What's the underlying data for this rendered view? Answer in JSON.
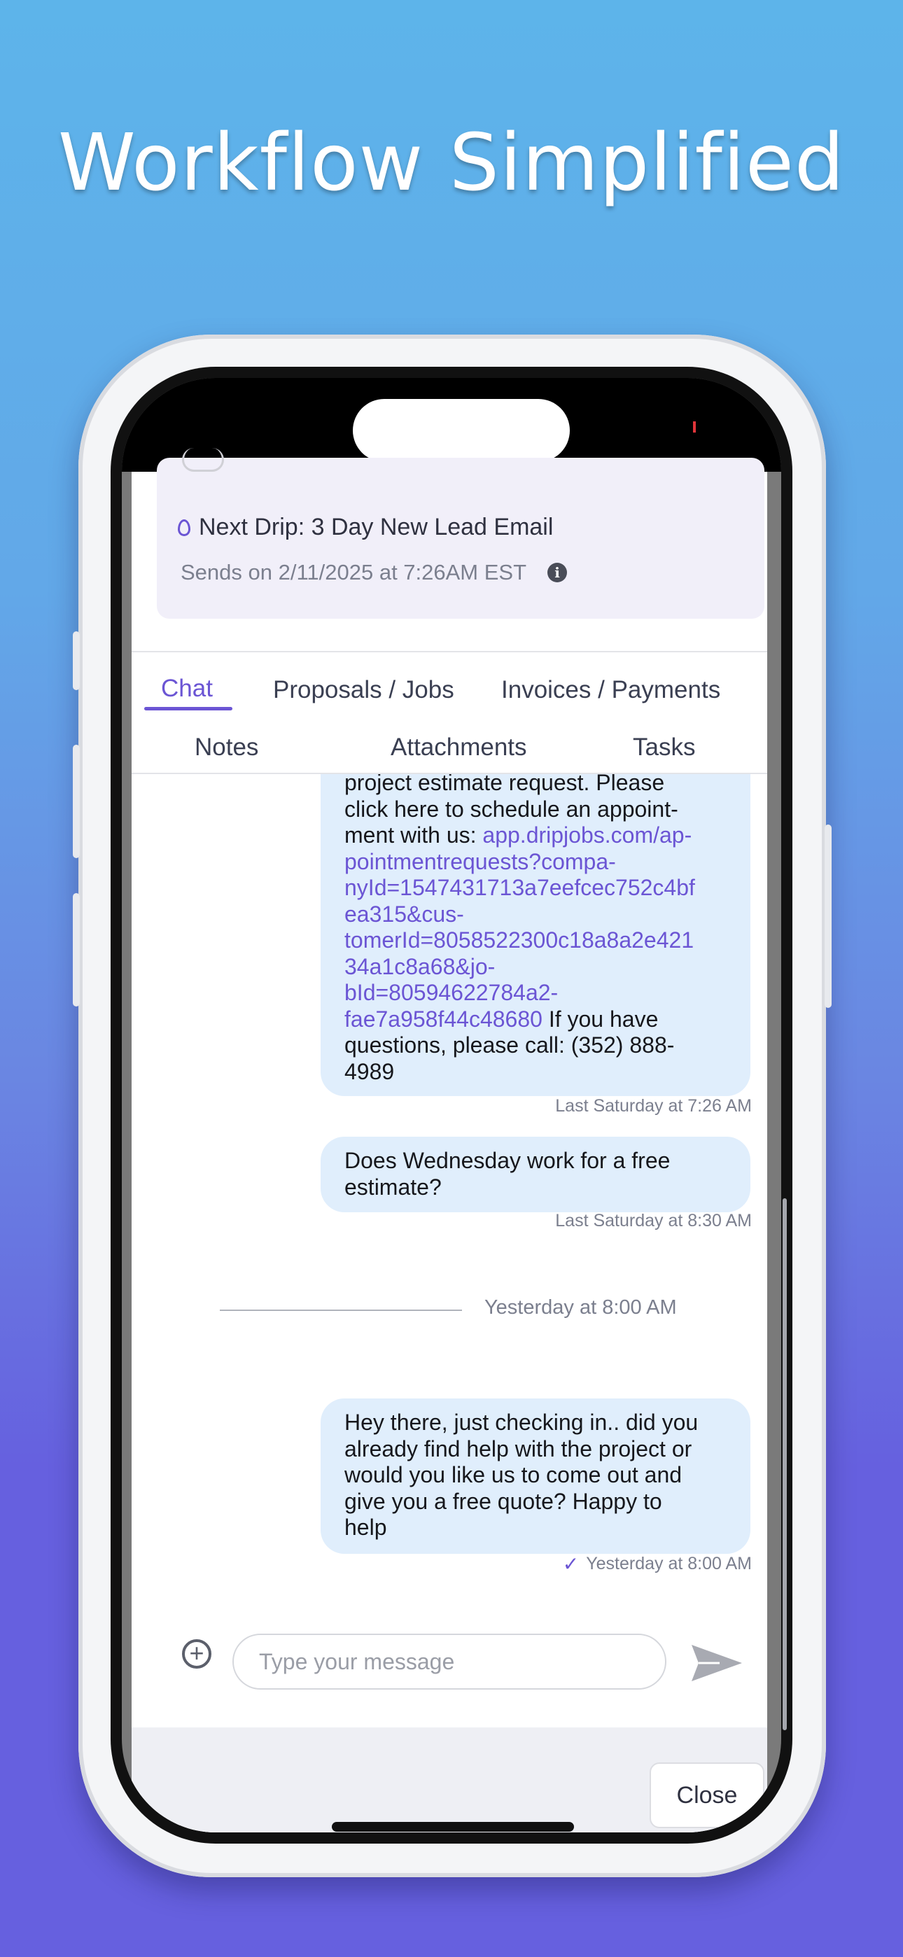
{
  "headline": "Workflow Simplified",
  "drip": {
    "title": "Next Drip: 3 Day New Lead Email",
    "sends": "Sends on 2/11/2025 at 7:26AM EST"
  },
  "tabs": {
    "row1": [
      "Chat",
      "Proposals / Jobs",
      "Invoices / Payments"
    ],
    "row2": [
      "Notes",
      "Attachments",
      "Tasks"
    ],
    "active": "Chat"
  },
  "messages": [
    {
      "lines_plain_before": [
        "project estimate request. Please",
        "click here to schedule an appoint-",
        "ment with us: "
      ],
      "link_lines": [
        "app.dripjobs.com/ap-",
        "pointmentrequests?compa-",
        "nyId=1547431713a7eefcec752c4bf",
        "ea315&cus-",
        "tomerId=8058522300c18a8a2e421",
        "34a1c8a68&jo-",
        "bId=80594622784a2-",
        "fae7a958f44c48680"
      ],
      "after_link": " If you have",
      "lines_plain_after": [
        "questions, please call: (352) 888-",
        "4989"
      ],
      "timestamp": "Last Saturday at 7:26 AM"
    },
    {
      "lines": [
        "Does Wednesday work for a free",
        "estimate?"
      ],
      "timestamp": "Last Saturday at 8:30 AM"
    },
    {
      "lines": [
        "Hey there, just checking in.. did you",
        "already find help with the project or",
        "would you like us to come out and",
        "give you a free quote? Happy to",
        "help"
      ],
      "timestamp": "Yesterday at 8:00 AM"
    }
  ],
  "separator": "Yesterday at 8:00 AM",
  "composer": {
    "placeholder": "Type your message"
  },
  "footer": {
    "close_label": "Close"
  },
  "colors": {
    "accent": "#6b55d4",
    "bubble": "#e0eefc"
  }
}
